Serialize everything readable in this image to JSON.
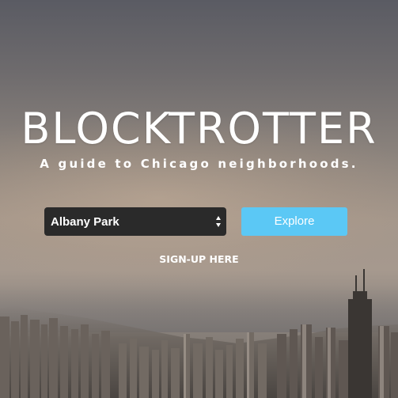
{
  "brand": {
    "title": "BLOCKTROTTER",
    "tagline": "A guide to Chicago neighborhoods."
  },
  "search": {
    "selected_neighborhood": "Albany Park",
    "explore_label": "Explore"
  },
  "signup": {
    "label": "SIGN-UP HERE"
  },
  "colors": {
    "explore_button": "#5bc8f5",
    "select_background": "#2a2a2a",
    "text": "#ffffff"
  },
  "icons": {
    "select_arrows": "up-down-arrows-icon"
  }
}
